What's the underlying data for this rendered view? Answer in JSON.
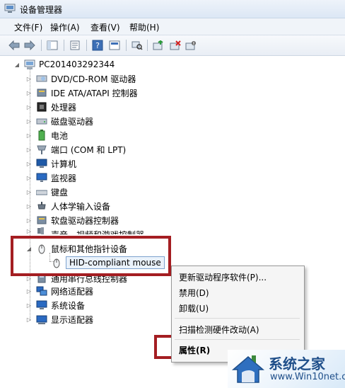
{
  "window": {
    "title": "设备管理器"
  },
  "menubar": [
    "文件(F)",
    "操作(A)",
    "查看(V)",
    "帮助(H)"
  ],
  "toolbar": {
    "icons": [
      "back-arrow-icon",
      "forward-arrow-icon",
      "show-hide-console-tree-icon",
      "properties-sheet-icon",
      "help-icon",
      "view-icon",
      "scan-hardware-icon",
      "update-driver-icon",
      "uninstall-icon",
      "disable-device-icon"
    ]
  },
  "tree": {
    "root": "PC201403292344",
    "items": [
      {
        "label": "DVD/CD-ROM 驱动器",
        "icon": "dvd-drive-icon"
      },
      {
        "label": "IDE ATA/ATAPI 控制器",
        "icon": "ide-controller-icon"
      },
      {
        "label": "处理器",
        "icon": "processor-icon"
      },
      {
        "label": "磁盘驱动器",
        "icon": "disk-drive-icon"
      },
      {
        "label": "电池",
        "icon": "battery-icon"
      },
      {
        "label": "端口 (COM 和 LPT)",
        "icon": "port-icon"
      },
      {
        "label": "计算机",
        "icon": "computer-icon"
      },
      {
        "label": "监视器",
        "icon": "monitor-icon"
      },
      {
        "label": "键盘",
        "icon": "keyboard-icon"
      },
      {
        "label": "人体学输入设备",
        "icon": "hid-icon"
      },
      {
        "label": "软盘驱动器控制器",
        "icon": "floppy-controller-icon"
      },
      {
        "label": "声音、视频和游戏控制器",
        "icon": "sound-icon"
      },
      {
        "label": "鼠标和其他指针设备",
        "icon": "mouse-icon"
      },
      {
        "label": "HID-compliant mouse",
        "icon": "mouse-icon"
      },
      {
        "label": "通用串行总线控制器",
        "icon": "usb-icon"
      },
      {
        "label": "网络适配器",
        "icon": "network-adapter-icon"
      },
      {
        "label": "系统设备",
        "icon": "system-device-icon"
      },
      {
        "label": "显示适配器",
        "icon": "display-adapter-icon"
      }
    ]
  },
  "context_menu": {
    "items": [
      "更新驱动程序软件(P)...",
      "禁用(D)",
      "卸载(U)",
      "扫描检测硬件改动(A)",
      "属性(R)"
    ]
  },
  "watermark": {
    "title": "系统之家",
    "site": "www.Win10net.com"
  },
  "colors": {
    "highlight": "#a41e22",
    "selection": "#eaf2fb",
    "selection_border": "#7da2ce"
  }
}
